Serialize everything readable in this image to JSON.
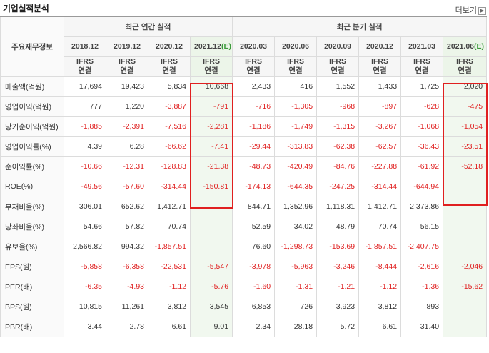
{
  "header": {
    "title": "기업실적분석",
    "more_label": "더보기",
    "more_icon": "chevron-right-icon"
  },
  "table": {
    "corner_label": "주요재무정보",
    "annual_group": "최근 연간 실적",
    "quarter_group": "최근 분기 실적",
    "annual_periods": [
      {
        "label": "2018.12",
        "estimate": false
      },
      {
        "label": "2019.12",
        "estimate": false
      },
      {
        "label": "2020.12",
        "estimate": false
      },
      {
        "label": "2021.12",
        "estimate_tag": "(E)",
        "estimate": true
      }
    ],
    "quarter_periods": [
      {
        "label": "2020.03",
        "estimate": false
      },
      {
        "label": "2020.06",
        "estimate": false
      },
      {
        "label": "2020.09",
        "estimate": false
      },
      {
        "label": "2020.12",
        "estimate": false
      },
      {
        "label": "2021.03",
        "estimate": false
      },
      {
        "label": "2021.06",
        "estimate_tag": "(E)",
        "estimate": true
      }
    ],
    "ifrs_top": "IFRS",
    "ifrs_bottom": "연결",
    "rows": [
      {
        "label": "매출액(억원)",
        "values": [
          "17,694",
          "19,423",
          "5,834",
          "10,668",
          "2,433",
          "416",
          "1,552",
          "1,433",
          "1,725",
          "2,020"
        ],
        "section_start": true
      },
      {
        "label": "영업이익(억원)",
        "values": [
          "777",
          "1,220",
          "-3,887",
          "-791",
          "-716",
          "-1,305",
          "-968",
          "-897",
          "-628",
          "-475"
        ]
      },
      {
        "label": "당기순이익(억원)",
        "values": [
          "-1,885",
          "-2,391",
          "-7,516",
          "-2,281",
          "-1,186",
          "-1,749",
          "-1,315",
          "-3,267",
          "-1,068",
          "-1,054"
        ]
      },
      {
        "label": "영업이익률(%)",
        "values": [
          "4.39",
          "6.28",
          "-66.62",
          "-7.41",
          "-29.44",
          "-313.83",
          "-62.38",
          "-62.57",
          "-36.43",
          "-23.51"
        ],
        "section_start": true
      },
      {
        "label": "순이익률(%)",
        "values": [
          "-10.66",
          "-12.31",
          "-128.83",
          "-21.38",
          "-48.73",
          "-420.49",
          "-84.76",
          "-227.88",
          "-61.92",
          "-52.18"
        ]
      },
      {
        "label": "ROE(%)",
        "values": [
          "-49.56",
          "-57.60",
          "-314.44",
          "-150.81",
          "-174.13",
          "-644.35",
          "-247.25",
          "-314.44",
          "-644.94",
          ""
        ]
      },
      {
        "label": "부채비율(%)",
        "values": [
          "306.01",
          "652.62",
          "1,412.71",
          "",
          "844.71",
          "1,352.96",
          "1,118.31",
          "1,412.71",
          "2,373.86",
          ""
        ],
        "section_start": true
      },
      {
        "label": "당좌비율(%)",
        "values": [
          "54.66",
          "57.82",
          "70.74",
          "",
          "52.59",
          "34.02",
          "48.79",
          "70.74",
          "56.15",
          ""
        ]
      },
      {
        "label": "유보율(%)",
        "values": [
          "2,566.82",
          "994.32",
          "-1,857.51",
          "",
          "76.60",
          "-1,298.73",
          "-153.69",
          "-1,857.51",
          "-2,407.75",
          ""
        ]
      },
      {
        "label": "EPS(원)",
        "values": [
          "-5,858",
          "-6,358",
          "-22,531",
          "-5,547",
          "-3,978",
          "-5,963",
          "-3,246",
          "-8,444",
          "-2,616",
          "-2,046"
        ],
        "section_start": true
      },
      {
        "label": "PER(배)",
        "values": [
          "-6.35",
          "-4.93",
          "-1.12",
          "-5.76",
          "-1.60",
          "-1.31",
          "-1.21",
          "-1.12",
          "-1.36",
          "-15.62"
        ]
      },
      {
        "label": "BPS(원)",
        "values": [
          "10,815",
          "11,261",
          "3,812",
          "3,545",
          "6,853",
          "726",
          "3,923",
          "3,812",
          "893",
          ""
        ]
      },
      {
        "label": "PBR(배)",
        "values": [
          "3.44",
          "2.78",
          "6.61",
          "9.01",
          "2.34",
          "28.18",
          "5.72",
          "6.61",
          "31.40",
          ""
        ]
      }
    ]
  },
  "colors": {
    "negative": "#e02020",
    "ifrs": "#e46a14",
    "estimate_bg": "#f1f8ef",
    "highlight_box": "#e02020"
  }
}
